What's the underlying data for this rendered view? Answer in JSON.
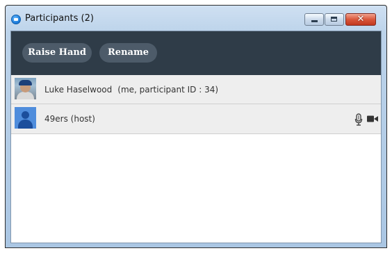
{
  "window": {
    "title": "Participants (2)",
    "close_glyph": "✕"
  },
  "toolbar": {
    "raise_hand_label": "Raise Hand",
    "rename_label": "Rename"
  },
  "participants": [
    {
      "name": "Luke Haselwood",
      "detail": "(me, participant ID : 34)",
      "avatar": "photo-avatar"
    },
    {
      "name": "49ers (host)",
      "detail": "",
      "avatar": "default-user-avatar",
      "icons": [
        "microphone-icon",
        "video-camera-icon"
      ]
    }
  ],
  "colors": {
    "toolbar_bg": "#2f3c48",
    "button_bg": "#4d5b69",
    "row_bg": "#eeeeee",
    "close_button": "#d9573b",
    "default_avatar": "#4f8ddc"
  }
}
